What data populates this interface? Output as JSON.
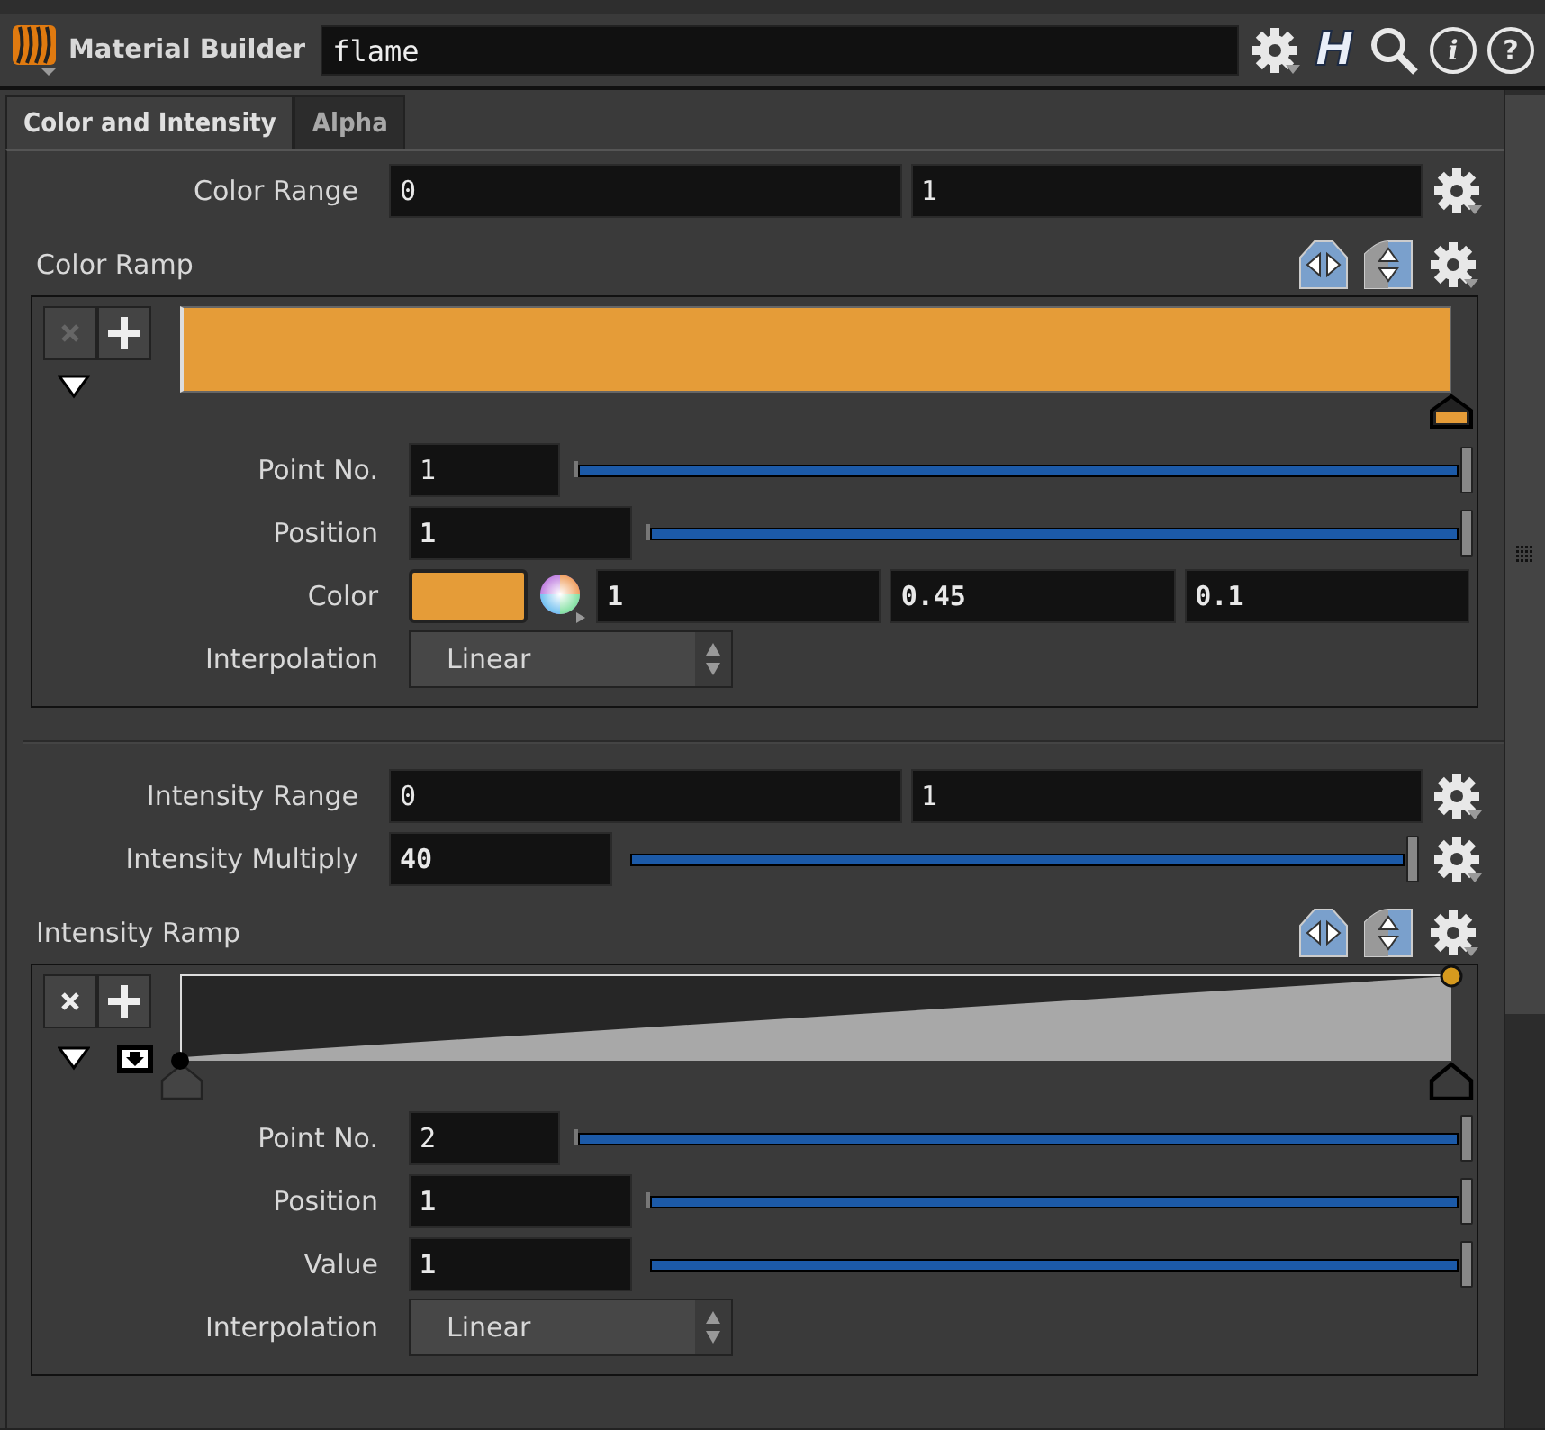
{
  "header": {
    "node_type": "Material Builder",
    "node_name": "flame",
    "logo_glyph": "H",
    "info_glyph": "i",
    "help_glyph": "?"
  },
  "tabs": [
    {
      "label": "Color and Intensity",
      "selected": true
    },
    {
      "label": "Alpha",
      "selected": false
    }
  ],
  "color_range": {
    "label": "Color Range",
    "min": "0",
    "max": "1"
  },
  "color_ramp": {
    "label": "Color Ramp",
    "delete_enabled": false,
    "point_no": {
      "label": "Point No.",
      "value": "1",
      "level": 1
    },
    "position": {
      "label": "Position",
      "value": "1",
      "level": 1
    },
    "color": {
      "label": "Color",
      "color": "#e59c38",
      "values": [
        "1",
        "0.45",
        "0.1"
      ]
    },
    "interpolation": {
      "label": "Interpolation",
      "value": "Linear"
    }
  },
  "intensity_range": {
    "label": "Intensity Range",
    "min": "0",
    "max": "1"
  },
  "intensity_multiply": {
    "label": "Intensity Multiply",
    "value": "40",
    "level": 1
  },
  "intensity_ramp": {
    "label": "Intensity Ramp",
    "delete_enabled": true,
    "point_no": {
      "label": "Point No.",
      "value": "2",
      "level": 1
    },
    "position": {
      "label": "Position",
      "value": "1",
      "level": 1
    },
    "value": {
      "label": "Value",
      "value": "1",
      "level": 1
    },
    "interpolation": {
      "label": "Interpolation",
      "value": "Linear"
    }
  }
}
